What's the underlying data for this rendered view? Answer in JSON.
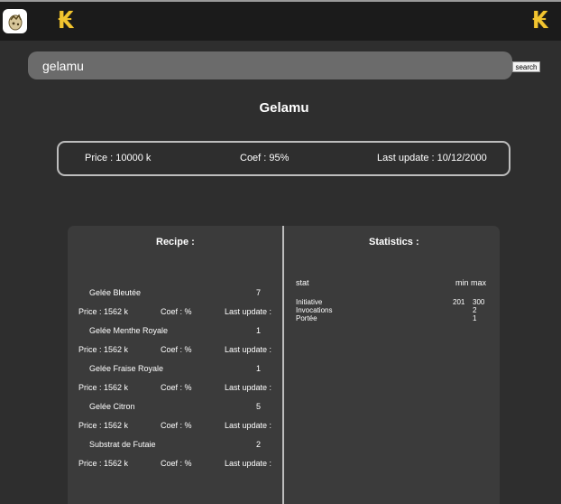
{
  "header": {
    "app_icon": "dofus-egg-icon",
    "currency_icon_left": "kamas-icon",
    "currency_icon_right": "kamas-icon",
    "currency_glyph": "₭"
  },
  "search": {
    "value": "gelamu",
    "button_label": "search"
  },
  "item": {
    "title": "Gelamu",
    "price": "Price : 10000 k",
    "coef": "Coef : 95%",
    "last_update": "Last update : 10/12/2000"
  },
  "recipe": {
    "title": "Recipe :",
    "ingredients": [
      {
        "name": "Gelée Bleutée",
        "qty": "7",
        "price": "Price : 1562 k",
        "coef": "Coef : %",
        "last_update": "Last update :"
      },
      {
        "name": "Gelée Menthe Royale",
        "qty": "1",
        "price": "Price : 1562 k",
        "coef": "Coef : %",
        "last_update": "Last update :"
      },
      {
        "name": "Gelée Fraise Royale",
        "qty": "1",
        "price": "Price : 1562 k",
        "coef": "Coef : %",
        "last_update": "Last update :"
      },
      {
        "name": "Gelée Citron",
        "qty": "5",
        "price": "Price : 1562 k",
        "coef": "Coef : %",
        "last_update": "Last update :"
      },
      {
        "name": "Substrat de Futaie",
        "qty": "2",
        "price": "Price : 1562 k",
        "coef": "Coef : %",
        "last_update": "Last update :"
      }
    ]
  },
  "statistics": {
    "title": "Statistics :",
    "col_stat": "stat",
    "col_minmax": "min max",
    "rows": [
      {
        "stat": "Initiative",
        "min": "201",
        "max": "300"
      },
      {
        "stat": "Invocations",
        "min": "",
        "max": "2"
      },
      {
        "stat": "Portée",
        "min": "",
        "max": "1"
      }
    ]
  },
  "colors": {
    "background": "#2e2e2e",
    "topbar": "#1b1b1b",
    "search_field": "#6b6b6b",
    "panel": "#3b3b3b",
    "border": "#bdbdbd",
    "kamas": "#f2c530"
  }
}
